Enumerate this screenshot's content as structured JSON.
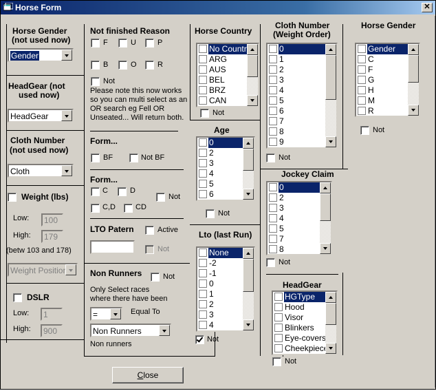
{
  "window": {
    "title": "Horse Form",
    "close_glyph": "✕"
  },
  "col1": {
    "horse_gender": {
      "title": "Horse Gender (not used now)",
      "combo_value": "Gender"
    },
    "headgear": {
      "title_line1": "HeadGear (not",
      "title_line2": "used now)",
      "combo_value": "HeadGear"
    },
    "cloth_number": {
      "title_line1": "Cloth Number",
      "title_line2": "(not used now)",
      "combo_value": "Cloth"
    },
    "weight": {
      "title": "Weight (lbs)",
      "checked": false,
      "low_label": "Low:",
      "low_value": "100",
      "high_label": "High:",
      "high_value": "179",
      "range_note": "(betw 103 and 178)",
      "position_combo": "Weight Position"
    },
    "dslr": {
      "title": "DSLR",
      "checked": false,
      "low_label": "Low:",
      "low_value": "1",
      "high_label": "High:",
      "high_value": "900"
    }
  },
  "col2": {
    "not_finished": {
      "title": "Not finished Reason",
      "options": [
        "F",
        "U",
        "P",
        "B",
        "O",
        "R"
      ],
      "not_label": "Not",
      "note": [
        "Please note this now works",
        "so you can multi select as an",
        "OR search eg Fell OR",
        "Unseated... Will return both."
      ]
    },
    "form1": {
      "title": "Form...",
      "options": [
        "BF",
        "Not BF"
      ]
    },
    "form2": {
      "title": "Form...",
      "options": [
        "C",
        "D",
        "C,D",
        "CD"
      ],
      "not_label": "Not"
    },
    "lto_pattern": {
      "title": "LTO Patern",
      "active_label": "Active",
      "not_label": "Not",
      "value": ""
    },
    "non_runners": {
      "title": "Non Runners",
      "not_label": "Not",
      "desc_line1": "Only Select races",
      "desc_line2": "where there have been",
      "operator": "=",
      "operator_label": "Equal To",
      "type_combo": "Non Runners",
      "footer": "Non runners"
    }
  },
  "col3": {
    "horse_country": {
      "title": "Horse Country",
      "items": [
        "No Country",
        "ARG",
        "AUS",
        "BEL",
        "BRZ",
        "CAN"
      ],
      "selected": 0,
      "not_label": "Not"
    },
    "age": {
      "title": "Age",
      "items": [
        "0",
        "2",
        "3",
        "4",
        "5",
        "6"
      ],
      "selected": 0,
      "not_label": "Not"
    },
    "lto_last_run": {
      "title": "Lto (last Run)",
      "items": [
        "None",
        "-2",
        "-1",
        "0",
        "1",
        "2",
        "3",
        "4"
      ],
      "selected": 0,
      "not_label": "Not",
      "not_checked": true
    }
  },
  "col4": {
    "cloth_number_weight": {
      "title_line1": "Cloth Number",
      "title_line2": "(Weight Order)",
      "items": [
        "0",
        "1",
        "2",
        "3",
        "4",
        "5",
        "6",
        "7",
        "8",
        "9"
      ],
      "selected": 0,
      "not_label": "Not"
    },
    "jockey_claim": {
      "title": "Jockey Claim",
      "items": [
        "0",
        "2",
        "3",
        "4",
        "5",
        "7",
        "8"
      ],
      "selected": 0,
      "not_label": "Not"
    },
    "headgear": {
      "title": "HeadGear",
      "items": [
        "HGType",
        "Hood",
        "Visor",
        "Blinkers",
        "Eye-covers",
        "Cheekpieces"
      ],
      "selected": 0,
      "not_label": "Not"
    }
  },
  "col5": {
    "horse_gender": {
      "title": "Horse Gender",
      "items": [
        "Gender",
        "C",
        "F",
        "G",
        "H",
        "M",
        "R"
      ],
      "selected": 0,
      "not_label": "Not"
    }
  },
  "footer": {
    "close_label_accel": "C",
    "close_label_rest": "lose"
  }
}
